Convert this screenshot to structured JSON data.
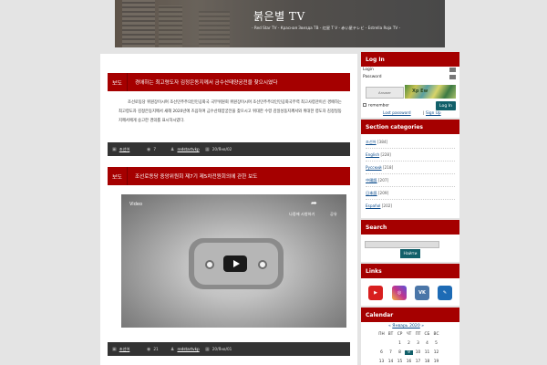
{
  "header": {
    "title": "붉은별 TV",
    "subtitle": "- Red Star TV - Красная Звезда ТВ - 红星 T V - 赤い星テレビ - Estrella Roja TV -"
  },
  "posts": [
    {
      "category": "보도",
      "title": "경애하는 최고령도자 김정은동지께서 금수산태양궁전을 찾으시였다",
      "body": "조선로동당 위원장이시며 조선민주주의인민공화국 국무위원회 위원장이시며 조선민주주의인민공화국무력 최고사령관이신 경애하는 최고령도자 김정은동지께서 새해 2020년에 즈음하여 금수산태양궁전을 찾으시고 위대한 수령 김일성동지께서와 위대한 령도자 김정일동지께서에게 숭고한 경의를 표시하시였다.",
      "meta": {
        "category": "조선어",
        "comments": "7",
        "author": "redstartvkp",
        "date": "20/Янв/02"
      }
    },
    {
      "category": "보도",
      "title": "조선로동당 중앙위원회 제7기 제5차전원회의에 관한 보도",
      "video": {
        "title": "Video",
        "watch_later": "나중에 시청하기",
        "share": "공유"
      },
      "meta": {
        "category": "조선어",
        "comments": "21",
        "author": "redstartvkp",
        "date": "20/Янв/01"
      }
    }
  ],
  "sidebar": {
    "login": {
      "heading": "Log In",
      "login_label": "Login",
      "password_label": "Password",
      "answer_placeholder": "Answer",
      "captcha_text": "Xp Ew",
      "remember_label": "remember",
      "login_button": "Log In",
      "lost_password": "Lost password",
      "separator": "|",
      "sign_up": "Sign Up"
    },
    "categories": {
      "heading": "Section categories",
      "items": [
        {
          "name": "조선어",
          "count": "[384]"
        },
        {
          "name": "English",
          "count": "[228]"
        },
        {
          "name": "Русский",
          "count": "[218]"
        },
        {
          "name": "中國語",
          "count": "[207]"
        },
        {
          "name": "日本語",
          "count": "[209]"
        },
        {
          "name": "Español",
          "count": "[202]"
        }
      ]
    },
    "search": {
      "heading": "Search",
      "button": "Найти"
    },
    "links": {
      "heading": "Links",
      "icons": [
        "youtube-icon",
        "instagram-icon",
        "vk-icon",
        "livejournal-icon"
      ],
      "icon_colors": [
        "#d81f1f",
        "#c1358e",
        "#4a76a8",
        "#1d6bb5"
      ]
    },
    "calendar": {
      "heading": "Calendar",
      "prev": "«",
      "month": "Январь 2020",
      "next": "»",
      "weekdays": [
        "ПН",
        "ВТ",
        "СР",
        "ЧТ",
        "ПТ",
        "СБ",
        "ВС"
      ],
      "rows": [
        [
          "",
          "",
          "1",
          "2",
          "3",
          "4",
          "5"
        ],
        [
          "6",
          "7",
          "8",
          "9",
          "10",
          "11",
          "12"
        ],
        [
          "13",
          "14",
          "15",
          "16",
          "17",
          "18",
          "19"
        ]
      ],
      "today": "9"
    }
  }
}
